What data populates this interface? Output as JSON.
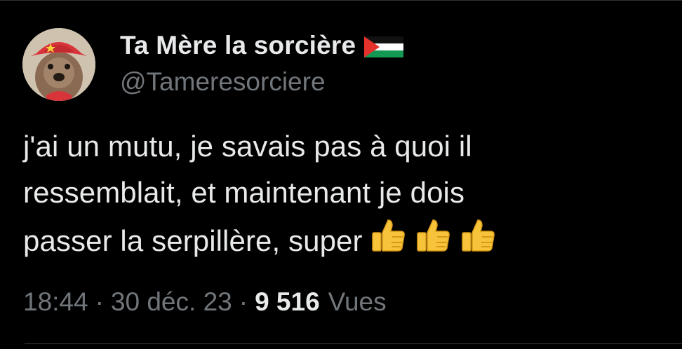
{
  "tweet": {
    "display_name": "Ta Mère la sorcière",
    "handle": "@Tameresorciere",
    "text": "j'ai un mutu, je savais pas à quoi il\nressemblait, et maintenant je dois\npasser la serpillère, super",
    "time": "18:44",
    "date": "30 déc. 23",
    "views_count": "9 516",
    "views_label": "Vues",
    "separator": "·",
    "flag_icon": "palestine-flag-icon",
    "emojis": [
      "thumbs-up-icon",
      "thumbs-up-icon",
      "thumbs-up-icon"
    ]
  },
  "colors": {
    "background": "#000000",
    "text": "#e7e9ea",
    "secondary": "#71767b",
    "divider": "#2f3336"
  }
}
